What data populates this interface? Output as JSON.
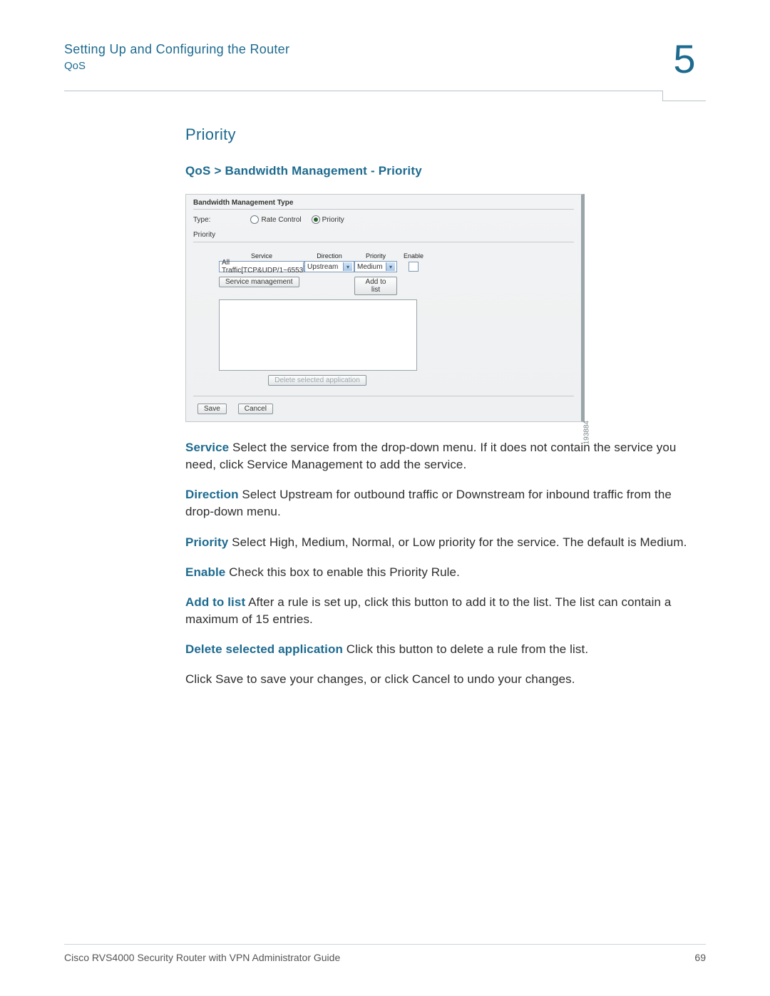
{
  "header": {
    "chapter_title": "Setting Up and Configuring the Router",
    "chapter_sub": "QoS",
    "chapter_number": "5"
  },
  "section": {
    "heading": "Priority",
    "breadcrumb": "QoS > Bandwidth Management - Priority"
  },
  "screenshot": {
    "bandwidth_title": "Bandwidth Management Type",
    "type_label": "Type:",
    "type_options": {
      "rate": "Rate Control",
      "priority": "Priority"
    },
    "priority_section": "Priority",
    "columns": {
      "service": "Service",
      "direction": "Direction",
      "priority": "Priority",
      "enable": "Enable"
    },
    "values": {
      "service": "All Traffic[TCP&UDP/1~6553",
      "direction": "Upstream",
      "priority": "Medium"
    },
    "buttons": {
      "service_mgmt": "Service management",
      "add": "Add to list",
      "delete": "Delete selected application",
      "save": "Save",
      "cancel": "Cancel"
    },
    "image_id": "193884"
  },
  "paras": {
    "service_term": "Service",
    "service_text": " Select the service from the drop-down menu. If it does not contain the service you need, click Service Management to add the service.",
    "direction_term": "Direction",
    "direction_text": " Select Upstream for outbound traffic or Downstream for inbound traffic from the drop-down menu.",
    "priority_term": "Priority",
    "priority_text": " Select High, Medium, Normal, or Low priority for the service. The default is Medium.",
    "enable_term": "Enable",
    "enable_text": " Check this box to enable this Priority Rule.",
    "add_term": "Add to list",
    "add_text": " After a rule is set up, click this button to add it to the list. The list can contain a maximum of 15 entries.",
    "delete_term": "Delete selected application",
    "delete_text": " Click this button to delete a rule from the list.",
    "save_text": "Click Save to save your changes, or click Cancel to undo your changes."
  },
  "footer": {
    "left": "Cisco RVS4000 Security Router with VPN Administrator Guide",
    "page": "69"
  }
}
